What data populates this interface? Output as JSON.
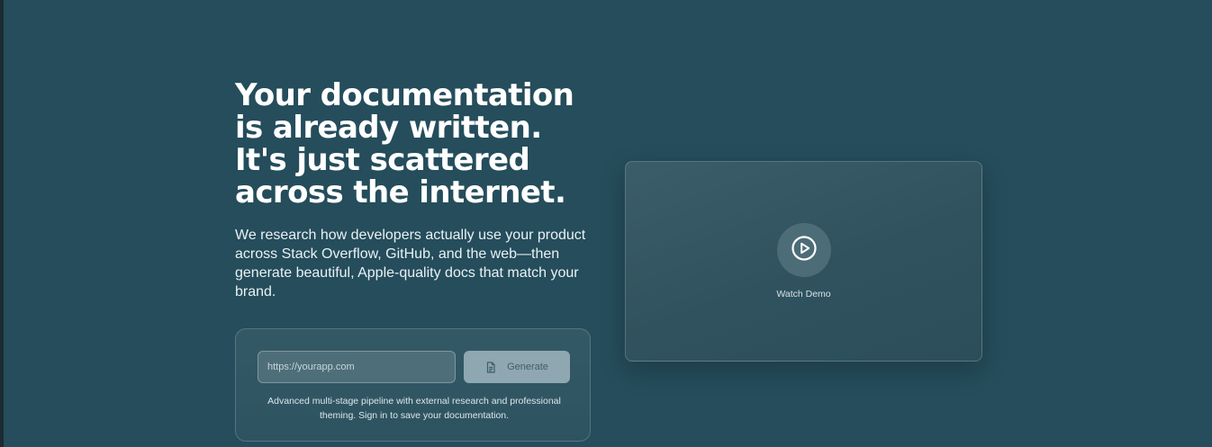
{
  "hero": {
    "headline": "Your documentation is already written. It's just scattered across the internet.",
    "subheadline": "We research how developers actually use your product across Stack Overflow, GitHub, and the web—then generate beautiful, Apple-quality docs that match your brand."
  },
  "generator": {
    "url_placeholder": "https://yourapp.com",
    "url_value": "",
    "generate_label": "Generate",
    "generate_icon": "document-icon",
    "note": "Advanced multi-stage pipeline with external research and professional theming. Sign in to save your documentation."
  },
  "demo": {
    "play_icon": "play-icon",
    "label": "Watch Demo"
  },
  "colors": {
    "background": "#254d5b",
    "button": "#8ea7b0",
    "button_text": "#425e68",
    "video_panel": "#3a5d69",
    "play_circle": "#4c6c77"
  }
}
